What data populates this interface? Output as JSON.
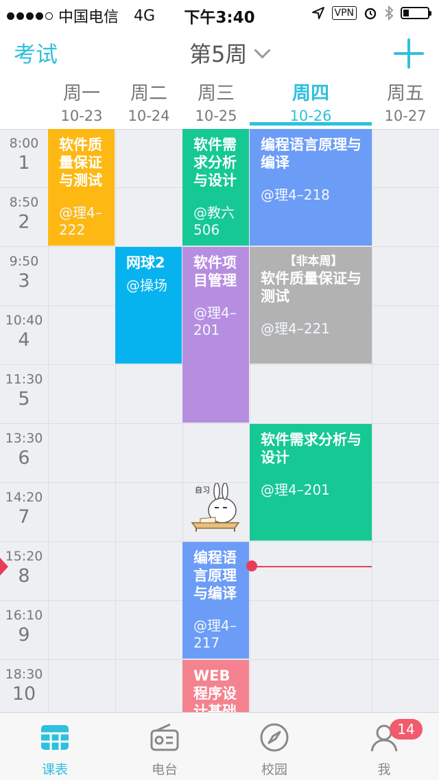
{
  "status": {
    "carrier": "中国电信",
    "network": "4G",
    "time": "下午3:40",
    "vpn": "VPN"
  },
  "nav": {
    "left": "考试",
    "title": "第5周"
  },
  "days": [
    {
      "week": "周一",
      "date": "10-23"
    },
    {
      "week": "周二",
      "date": "10-24"
    },
    {
      "week": "周三",
      "date": "10-25"
    },
    {
      "week": "周四",
      "date": "10-26"
    },
    {
      "week": "周五",
      "date": "10-27"
    }
  ],
  "slots": [
    {
      "time": "8:00",
      "num": "1"
    },
    {
      "time": "8:50",
      "num": "2"
    },
    {
      "time": "9:50",
      "num": "3"
    },
    {
      "time": "10:40",
      "num": "4"
    },
    {
      "time": "11:30",
      "num": "5"
    },
    {
      "time": "13:30",
      "num": "6"
    },
    {
      "time": "14:20",
      "num": "7"
    },
    {
      "time": "15:20",
      "num": "8"
    },
    {
      "time": "16:10",
      "num": "9"
    },
    {
      "time": "18:30",
      "num": "10"
    }
  ],
  "courses": {
    "c1": {
      "name": "软件质量保证与测试",
      "loc": "@理4–222",
      "color": "#fdb813"
    },
    "c2": {
      "name": "软件需求分析与设计",
      "loc": "@教六506",
      "color": "#16c893"
    },
    "c3": {
      "name": "编程语言原理与编译",
      "loc": "@理4–218",
      "color": "#6b9cf6"
    },
    "c4": {
      "name": "网球2",
      "loc": "@操场",
      "color": "#06b3ee"
    },
    "c5": {
      "name": "软件项目管理",
      "loc": "@理4–201",
      "color": "#b68ee0"
    },
    "c6": {
      "tag": "【非本周】",
      "name": "软件质量保证与测试",
      "loc": "@理4–221",
      "color": "#b2b2b2"
    },
    "c7": {
      "name": "软件需求分析与设计",
      "loc": "@理4–201",
      "color": "#16c893"
    },
    "c8": {
      "name": "编程语言原理与编译",
      "loc": "@理4–217",
      "color": "#6b9cf6"
    },
    "c9": {
      "name": "WEB程序设计基础",
      "loc": "",
      "color": "#f4828f"
    }
  },
  "bunny_label": "自习",
  "tabs": [
    {
      "label": "课表",
      "icon": "timetable-icon"
    },
    {
      "label": "电台",
      "icon": "radio-icon"
    },
    {
      "label": "校园",
      "icon": "compass-icon"
    },
    {
      "label": "我",
      "icon": "profile-icon"
    }
  ],
  "badge": "14",
  "colors": {
    "accent": "#2ec0dd",
    "now": "#e83d5a"
  }
}
